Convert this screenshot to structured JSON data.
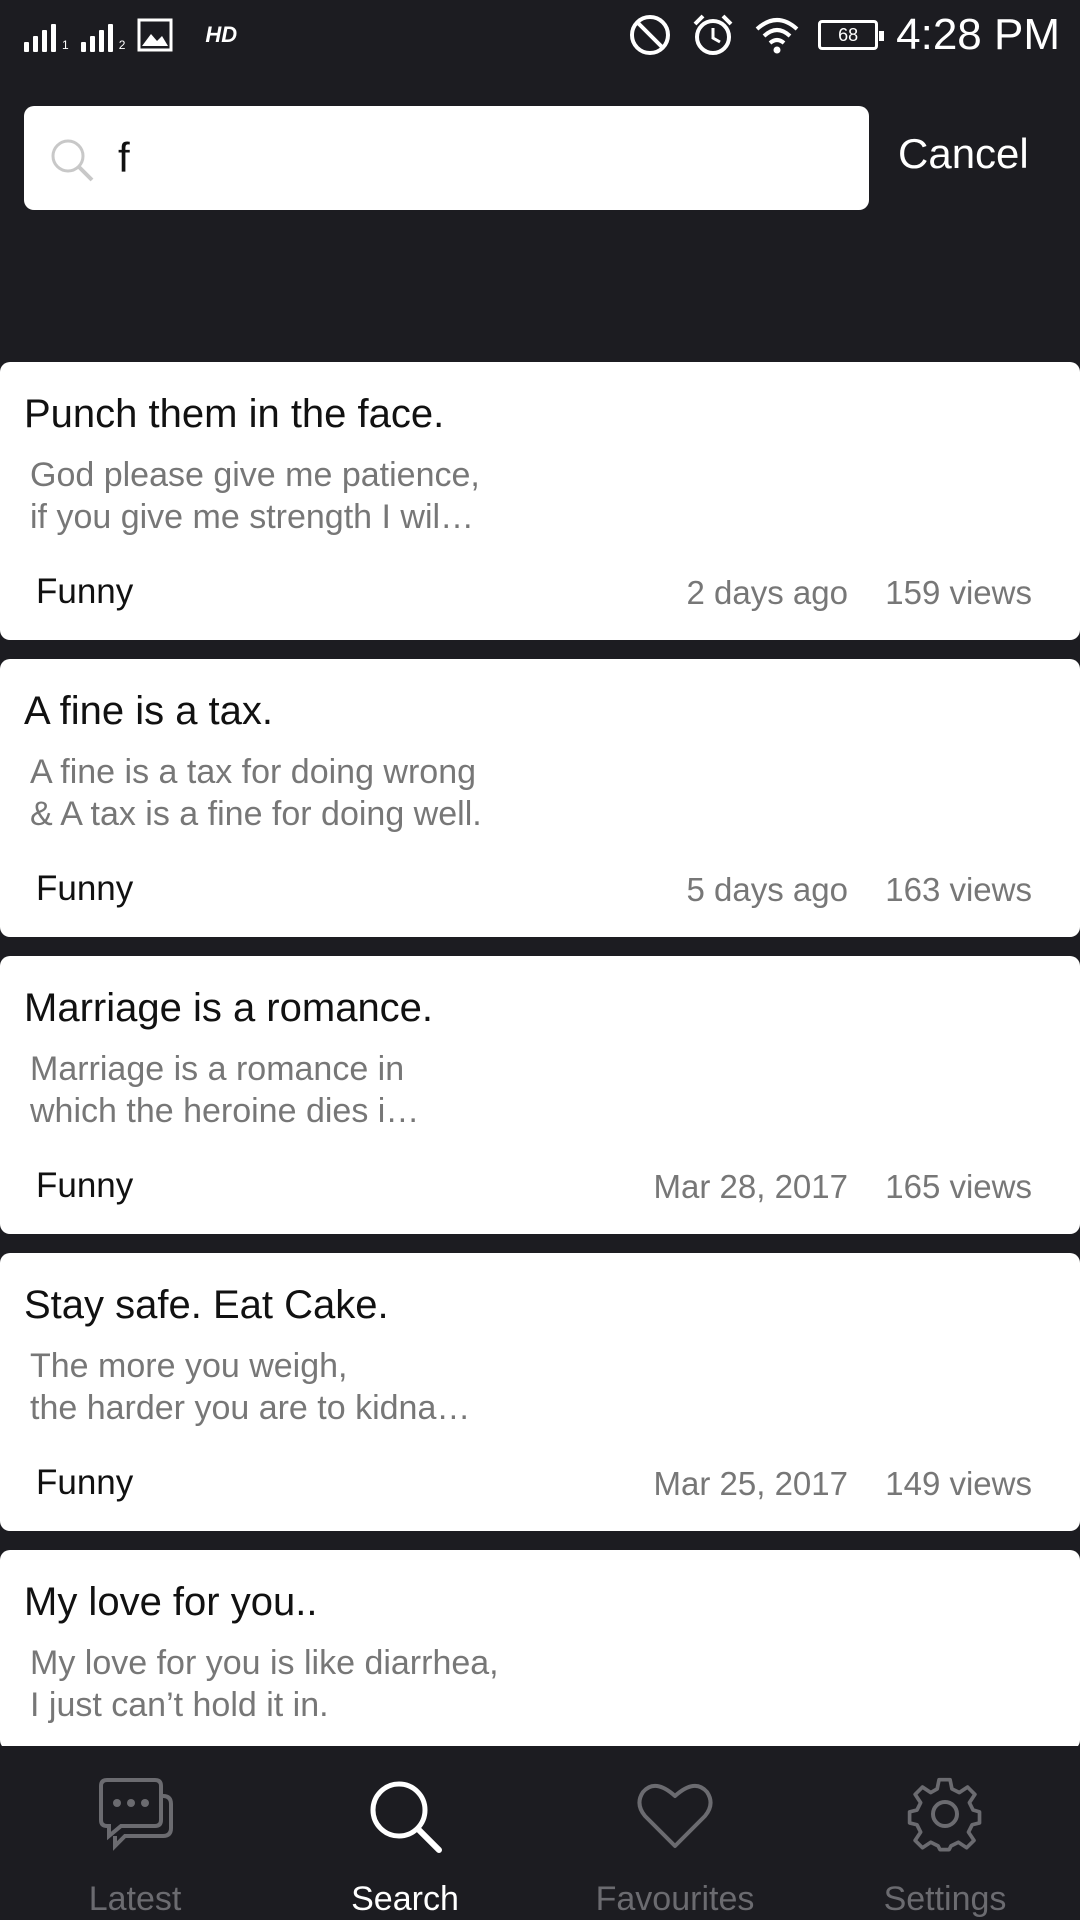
{
  "status_bar": {
    "network": "HD",
    "battery": "68",
    "time": "4:28 PM"
  },
  "search": {
    "value": "f",
    "cancel_label": "Cancel"
  },
  "results": [
    {
      "title": "Punch them in the face.",
      "excerpt": "God please give me patience,\nif you give me strength I wil…",
      "category": "Funny",
      "date": "2 days ago",
      "views": "159 views"
    },
    {
      "title": "A fine is a tax.",
      "excerpt": "A fine is a tax for doing wrong\n& A tax is a fine for doing well.",
      "category": "Funny",
      "date": "5 days ago",
      "views": "163 views"
    },
    {
      "title": "Marriage is a romance.",
      "excerpt": "Marriage is a romance in\nwhich the heroine dies i…",
      "category": "Funny",
      "date": "Mar 28, 2017",
      "views": "165 views"
    },
    {
      "title": "Stay safe. Eat Cake.",
      "excerpt": "The more you weigh,\nthe harder you are to kidna…",
      "category": "Funny",
      "date": "Mar 25, 2017",
      "views": "149 views"
    },
    {
      "title": "My love for you..",
      "excerpt": "My love for you is like diarrhea,\nI just can’t hold it in.",
      "category": "",
      "date": "",
      "views": ""
    }
  ],
  "tabs": [
    {
      "label": "Latest",
      "icon": "chat-bubbles-icon",
      "active": false
    },
    {
      "label": "Search",
      "icon": "search-icon",
      "active": true
    },
    {
      "label": "Favourites",
      "icon": "heart-icon",
      "active": false
    },
    {
      "label": "Settings",
      "icon": "gear-icon",
      "active": false
    }
  ],
  "colors": {
    "background": "#1c1c21",
    "card": "#ffffff",
    "tab_inactive": "#6b6b70",
    "tab_active": "#ffffff"
  }
}
